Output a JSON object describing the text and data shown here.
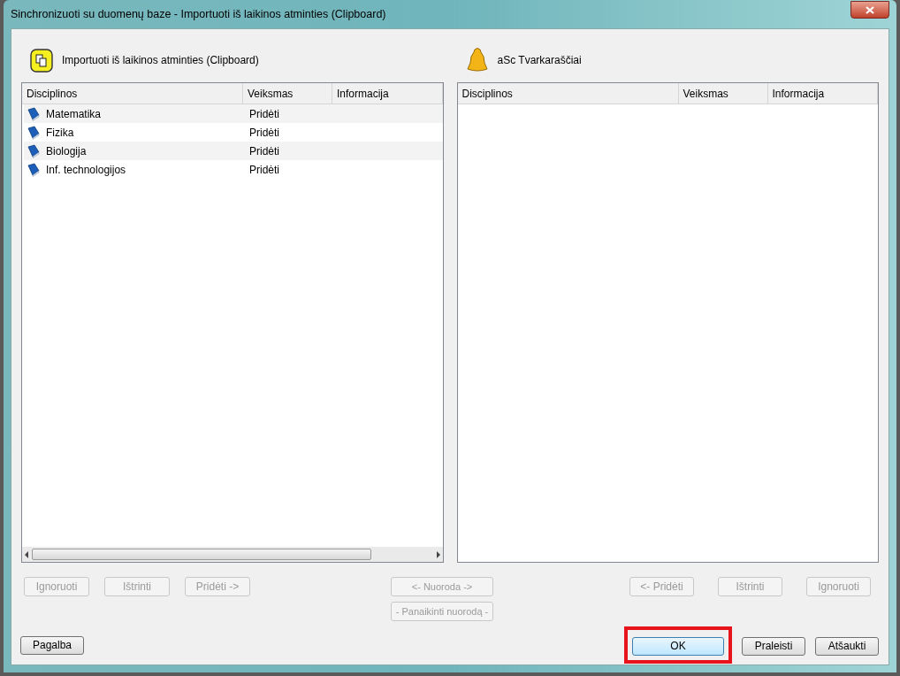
{
  "window": {
    "title": "Sinchronizuoti su duomenų baze - Importuoti iš laikinos atminties (Clipboard)"
  },
  "left_panel": {
    "title": "Importuoti iš laikinos atminties (Clipboard)",
    "columns": [
      "Disciplinos",
      "Veiksmas",
      "Informacija"
    ],
    "rows": [
      {
        "name": "Matematika",
        "action": "Pridėti"
      },
      {
        "name": "Fizika",
        "action": "Pridėti"
      },
      {
        "name": "Biologija",
        "action": "Pridėti"
      },
      {
        "name": "Inf. technologijos",
        "action": "Pridėti"
      }
    ],
    "buttons": [
      {
        "label": "Ignoruoti",
        "disabled": true
      },
      {
        "label": "Ištrinti",
        "disabled": true
      },
      {
        "label": "Pridėti ->",
        "disabled": true
      }
    ]
  },
  "right_panel": {
    "title": "aSc Tvarkaraščiai",
    "columns": [
      "Disciplinos",
      "Veiksmas",
      "Informacija"
    ],
    "buttons": [
      {
        "label": "<- Pridėti",
        "disabled": true
      },
      {
        "label": "Ištrinti",
        "disabled": true
      },
      {
        "label": "Ignoruoti",
        "disabled": true
      }
    ]
  },
  "middle_buttons": [
    {
      "label": "<- Nuoroda ->",
      "disabled": true
    },
    {
      "label": "- Panaikinti nuorodą -",
      "disabled": true
    }
  ],
  "help_button": {
    "label": "Pagalba"
  },
  "dialog_buttons": [
    {
      "label": "OK",
      "default": true,
      "highlighted": true
    },
    {
      "label": "Praleisti",
      "default": false,
      "highlighted": false
    },
    {
      "label": "Atšaukti",
      "default": false,
      "highlighted": false
    }
  ]
}
